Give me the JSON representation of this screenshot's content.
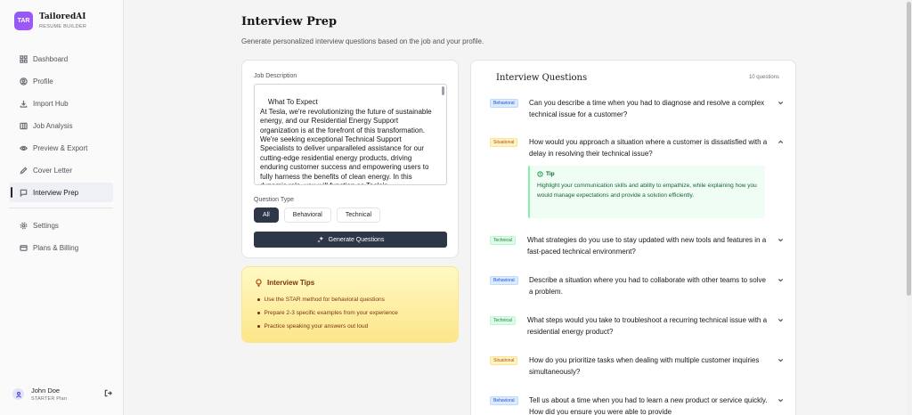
{
  "brand": {
    "logo_text": "TAR",
    "name": "TailoredAI",
    "subtitle": "RESUME BUILDER"
  },
  "sidebar": {
    "items": [
      {
        "label": "Dashboard",
        "icon": "grid-icon"
      },
      {
        "label": "Profile",
        "icon": "user-circle-icon"
      },
      {
        "label": "Import Hub",
        "icon": "download-icon"
      },
      {
        "label": "Job Analysis",
        "icon": "columns-icon"
      },
      {
        "label": "Preview & Export",
        "icon": "eye-icon"
      },
      {
        "label": "Cover Letter",
        "icon": "pen-icon"
      },
      {
        "label": "Interview Prep",
        "icon": "chat-icon",
        "active": true
      }
    ],
    "secondary": [
      {
        "label": "Settings",
        "icon": "gear-icon"
      },
      {
        "label": "Plans & Billing",
        "icon": "credit-card-icon"
      }
    ]
  },
  "user": {
    "name": "John Doe",
    "plan": "STARTER Plan"
  },
  "header": {
    "title": "Interview Prep",
    "subtitle": "Generate personalized interview questions based on the job and your profile."
  },
  "form": {
    "job_description_label": "Job Description",
    "job_description_value": "What To Expect\nAt Tesla, we're revolutionizing the future of sustainable energy, and our Residential Energy Support organization is at the forefront of this transformation. We're seeking exceptional Technical Support Specialists to deliver unparalleled assistance for our cutting-edge residential energy products, driving enduring customer success and empowering users to fully harness the benefits of clean energy. In this dynamic role, you will function as Tesla's",
    "question_type_label": "Question Type",
    "types": [
      "All",
      "Behavioral",
      "Technical"
    ],
    "selected_type": "All",
    "generate_label": "Generate Questions"
  },
  "tips": {
    "title": "Interview Tips",
    "items": [
      "Use the STAR method for behavioral questions",
      "Prepare 2-3 specific examples from your experience",
      "Practice speaking your answers out loud"
    ]
  },
  "questions_panel": {
    "title": "Interview Questions",
    "count": "10 questions",
    "questions": [
      {
        "type": "Behavioral",
        "text": "Can you describe a time when you had to diagnose and resolve a complex technical issue for a customer?"
      },
      {
        "type": "Situational",
        "text": "How would you approach a situation where a customer is dissatisfied with a delay in resolving their technical issue?",
        "expanded": true
      },
      {
        "type": "Technical",
        "text": "What strategies do you use to stay updated with new tools and features in a fast-paced technical environment?"
      },
      {
        "type": "Behavioral",
        "text": "Describe a situation where you had to collaborate with other teams to solve a problem."
      },
      {
        "type": "Technical",
        "text": "What steps would you take to troubleshoot a recurring technical issue with a residential energy product?"
      },
      {
        "type": "Situational",
        "text": "How do you prioritize tasks when dealing with multiple customer inquiries simultaneously?"
      },
      {
        "type": "Behavioral",
        "text": "Tell us about a time when you had to learn a new product or service quickly. How did you ensure you were able to provide"
      }
    ],
    "tip": {
      "title": "Tip",
      "text": "Highlight your communication skills and ability to empathize, while explaining how you would manage expectations and provide a solution efficiently."
    }
  }
}
